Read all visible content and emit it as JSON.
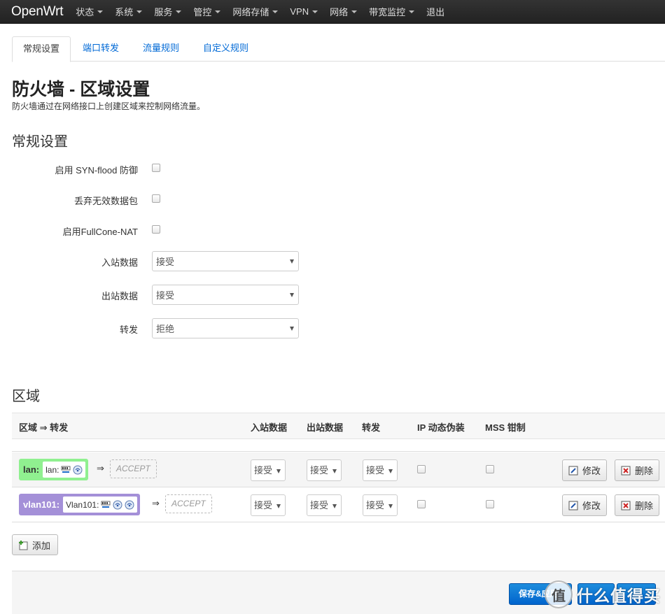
{
  "navbar": {
    "brand": "OpenWrt",
    "items": [
      {
        "label": "状态",
        "caret": true
      },
      {
        "label": "系统",
        "caret": true
      },
      {
        "label": "服务",
        "caret": true
      },
      {
        "label": "管控",
        "caret": true
      },
      {
        "label": "网络存储",
        "caret": true
      },
      {
        "label": "VPN",
        "caret": true
      },
      {
        "label": "网络",
        "caret": true
      },
      {
        "label": "带宽监控",
        "caret": true
      },
      {
        "label": "退出",
        "caret": false
      }
    ]
  },
  "tabs": [
    "常规设置",
    "端口转发",
    "流量规则",
    "自定义规则"
  ],
  "page": {
    "title": "防火墙 - 区域设置",
    "description": "防火墙通过在网络接口上创建区域来控制网络流量。"
  },
  "general": {
    "heading": "常规设置",
    "syn_flood_label": "启用 SYN-flood 防御",
    "drop_invalid_label": "丢弃无效数据包",
    "fullcone_label": "启用FullCone-NAT",
    "input_label": "入站数据",
    "input_value": "接受",
    "output_label": "出站数据",
    "output_value": "接受",
    "forward_label": "转发",
    "forward_value": "拒绝"
  },
  "zones": {
    "heading": "区域",
    "columns": {
      "zone": "区域 ⇒ 转发",
      "input": "入站数据",
      "output": "出站数据",
      "forward": "转发",
      "masq": "IP 动态伪装",
      "mss": "MSS 钳制"
    },
    "rows": [
      {
        "name": "lan:",
        "iface": "lan:",
        "color": "#90f090",
        "arrow": "⇒",
        "target": "ACCEPT",
        "input": "接受",
        "output": "接受",
        "forward": "接受",
        "edit": "修改",
        "delete": "删除"
      },
      {
        "name": "vlan101:",
        "iface": "Vlan101:",
        "color": "#a490d8",
        "arrow": "⇒",
        "target": "ACCEPT",
        "input": "接受",
        "output": "接受",
        "forward": "接受",
        "edit": "修改",
        "delete": "删除"
      }
    ],
    "add_label": "添加"
  },
  "footer": {
    "save_apply": "保存&应用"
  },
  "watermark": {
    "circle": "值",
    "text": "什么值得买"
  },
  "colors": {
    "accent": "#0069d6",
    "primary": "#0064cd",
    "navbar": "#222222"
  }
}
